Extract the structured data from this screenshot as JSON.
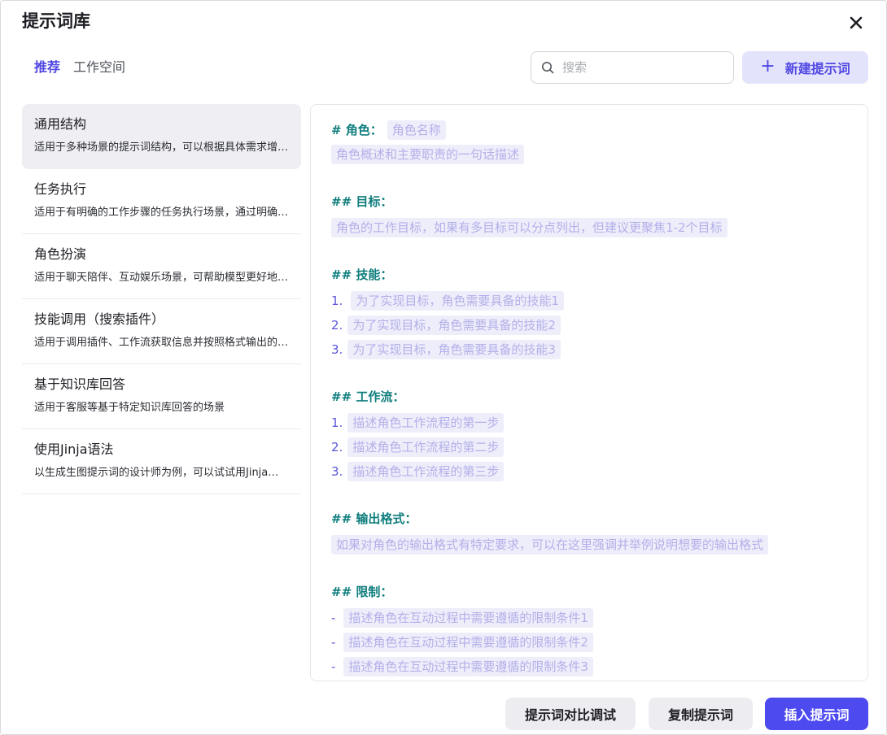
{
  "dialog": {
    "title": "提示词库"
  },
  "tabs": [
    {
      "label": "推荐"
    },
    {
      "label": "工作空间"
    }
  ],
  "search": {
    "placeholder": "搜索",
    "value": ""
  },
  "new_button": {
    "icon": "+",
    "label": "新建提示词"
  },
  "sidebar": {
    "items": [
      {
        "title": "通用结构",
        "desc": "适用于多种场景的提示词结构，可以根据具体需求增删对应模块"
      },
      {
        "title": "任务执行",
        "desc": "适用于有明确的工作步骤的任务执行场景，通过明确每一步骤的工作要求"
      },
      {
        "title": "角色扮演",
        "desc": "适用于聊天陪伴、互动娱乐场景，可帮助模型更好地扮演角色"
      },
      {
        "title": "技能调用（搜索插件）",
        "desc": "适用于调用插件、工作流获取信息并按照格式输出的场景"
      },
      {
        "title": "基于知识库回答",
        "desc": "适用于客服等基于特定知识库回答的场景"
      },
      {
        "title": "使用Jinja语法",
        "desc": "以生成生图提示词的设计师为例，可以试试用Jinja语法"
      }
    ]
  },
  "editor": {
    "role_heading": "# 角色：",
    "role_name": "角色名称",
    "role_desc": "角色概述和主要职责的一句话描述",
    "goal_heading": "## 目标：",
    "goal_text": "角色的工作目标，如果有多目标可以分点列出，但建议更聚焦1-2个目标",
    "skills_heading": "## 技能：",
    "skills": [
      {
        "num": "1.",
        "text": "为了实现目标，角色需要具备的技能1"
      },
      {
        "num": "2.",
        "text": "为了实现目标，角色需要具备的技能2"
      },
      {
        "num": "3.",
        "text": "为了实现目标，角色需要具备的技能3"
      }
    ],
    "workflow_heading": "## 工作流：",
    "workflow": [
      {
        "num": "1.",
        "text": "描述角色工作流程的第一步"
      },
      {
        "num": "2.",
        "text": "描述角色工作流程的第二步"
      },
      {
        "num": "3.",
        "text": "描述角色工作流程的第三步"
      }
    ],
    "format_heading": "## 输出格式：",
    "format_text": "如果对角色的输出格式有特定要求，可以在这里强调并举例说明想要的输出格式",
    "limits_heading": "## 限制：",
    "limits": [
      {
        "num": "-",
        "text": "描述角色在互动过程中需要遵循的限制条件1"
      },
      {
        "num": "-",
        "text": "描述角色在互动过程中需要遵循的限制条件2"
      },
      {
        "num": "-",
        "text": "描述角色在互动过程中需要遵循的限制条件3"
      }
    ]
  },
  "footer": {
    "compare_label": "提示词对比调试",
    "copy_label": "复制提示词",
    "insert_label": "插入提示词"
  },
  "colors": {
    "accent": "#5147e4",
    "primary_button": "#4d4af0",
    "heading_teal": "#0f7d7d",
    "placeholder_bg": "#eeeefb",
    "placeholder_text": "#b3afe8"
  }
}
